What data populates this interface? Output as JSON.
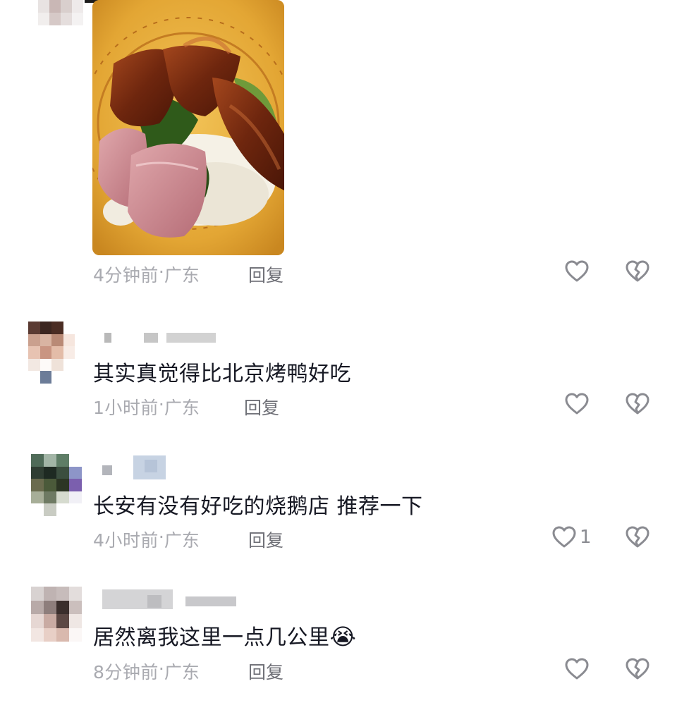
{
  "comments": [
    {
      "text": "",
      "time": "4分钟前",
      "region": "广东",
      "reply": "回复",
      "likes": ""
    },
    {
      "text": "其实真觉得比北京烤鸭好吃",
      "time": "1小时前",
      "region": "广东",
      "reply": "回复",
      "likes": ""
    },
    {
      "text": "长安有没有好吃的烧鹅店 推荐一下",
      "time": "4小时前",
      "region": "广东",
      "reply": "回复",
      "likes": "1"
    },
    {
      "text": "居然离我这里一点几公里",
      "emoji": "😭",
      "time": "8分钟前",
      "region": "广东",
      "reply": "回复",
      "likes": ""
    }
  ],
  "separator": " · ",
  "icons": {
    "like": "heart-outline-icon",
    "dislike": "broken-heart-icon"
  },
  "colors": {
    "text": "#161823",
    "meta": "#a9aab0",
    "reply": "#6f7077",
    "icon": "#8a8b91"
  }
}
